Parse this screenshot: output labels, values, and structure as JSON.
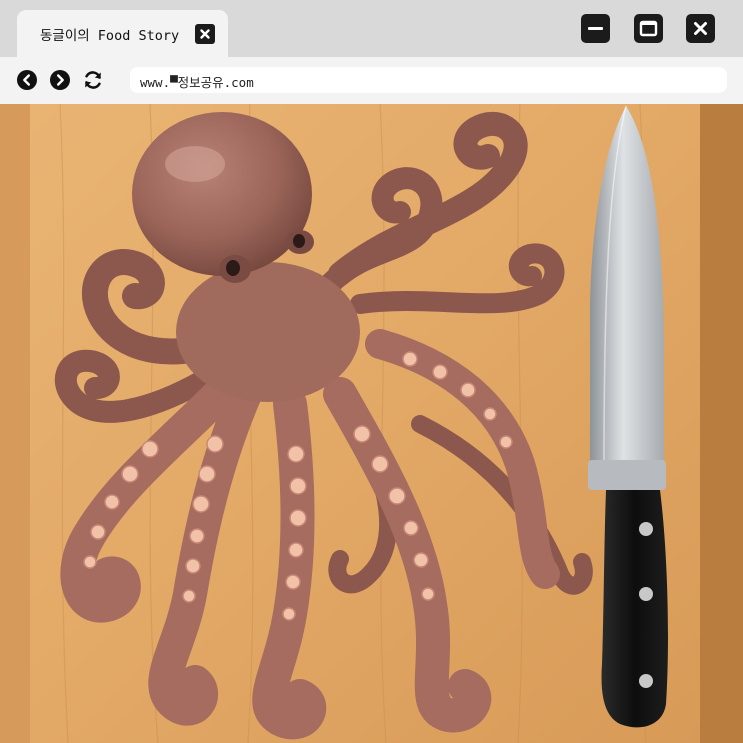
{
  "window": {
    "tab_title": "동글이의 Food Story",
    "address_bar": {
      "url": "www.▀정보공유.com"
    }
  },
  "icons": {
    "tab_close": "close-icon",
    "minimize": "minimize-icon",
    "maximize": "maximize-icon",
    "close": "close-icon",
    "back": "arrow-left-icon",
    "forward": "arrow-right-icon",
    "reload": "reload-icon"
  },
  "content": {
    "image_subject": "octopus-and-knife-on-cutting-board"
  },
  "colors": {
    "titlebar_bg": "#d9d9d9",
    "tab_bg": "#f3f3f3",
    "button_dark": "#1b1b1b",
    "board_wood": "#e2a866",
    "octopus_skin": "#9a6458",
    "knife_blade": "#c6c9cc",
    "knife_handle": "#141414"
  }
}
